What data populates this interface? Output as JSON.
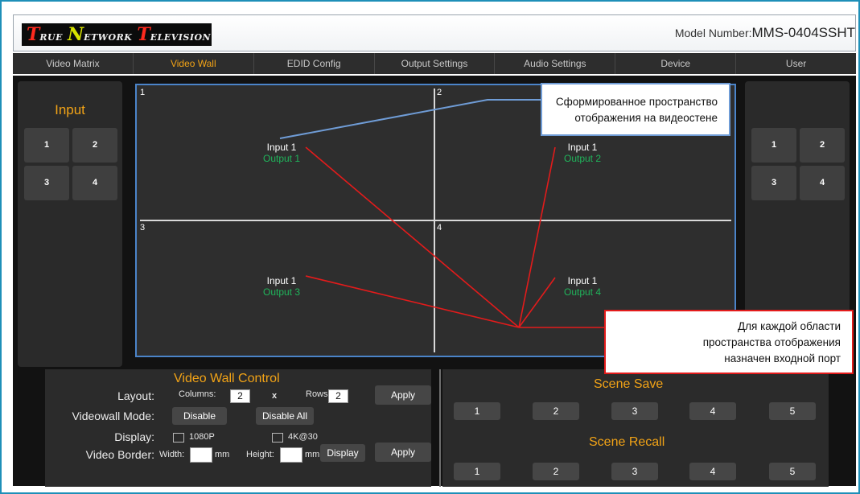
{
  "header": {
    "logo_text": "True Network Television",
    "logo_parts": [
      {
        "cap": "T",
        "rest": "RUE"
      },
      {
        "cap": "N",
        "rest": "ETWORK"
      },
      {
        "cap": "T",
        "rest": "ELEVISION"
      }
    ],
    "model_label": "Model Number:",
    "model_value": "MMS-0404SSHT"
  },
  "nav": {
    "tabs": [
      "Video Matrix",
      "Video Wall",
      "EDID Config",
      "Output Settings",
      "Audio Settings",
      "Device",
      "User"
    ],
    "active": "Video Wall"
  },
  "input_panel": {
    "title": "Input",
    "buttons": [
      "1",
      "2",
      "3",
      "4"
    ]
  },
  "output_panel": {
    "buttons": [
      "1",
      "2",
      "3",
      "4"
    ]
  },
  "wall": {
    "cells": [
      {
        "number": "1",
        "input": "Input 1",
        "output": "Output 1"
      },
      {
        "number": "2",
        "input": "Input 1",
        "output": "Output 2"
      },
      {
        "number": "3",
        "input": "Input 1",
        "output": "Output 3"
      },
      {
        "number": "4",
        "input": "Input 1",
        "output": "Output 4"
      }
    ]
  },
  "control": {
    "title": "Video Wall Control",
    "layout_label": "Layout:",
    "columns_label": "Columns:",
    "columns_value": "2",
    "x_label": "x",
    "rows_label": "Rows:",
    "rows_value": "2",
    "apply_label": "Apply",
    "mode_label": "Videowall Mode:",
    "disable_label": "Disable",
    "disable_all_label": "Disable All",
    "display_label": "Display:",
    "opt_1080p": "1080P",
    "opt_4k30": "4K@30",
    "border_label": "Video Border:",
    "width_label": "Width:",
    "mm_label": "mm",
    "height_label": "Height:",
    "display_btn_label": "Display",
    "apply2_label": "Apply"
  },
  "scene": {
    "save_title": "Scene Save",
    "save_buttons": [
      "1",
      "2",
      "3",
      "4",
      "5"
    ],
    "recall_title": "Scene Recall",
    "recall_buttons": [
      "1",
      "2",
      "3",
      "4",
      "5"
    ]
  },
  "annotations": {
    "blue_text": [
      "Сформированное пространство",
      "отображения на видеостене"
    ],
    "red_text": [
      "Для каждой области",
      "пространства отображения",
      "назначен входной порт"
    ],
    "colors": {
      "blue": "#6f9cd6",
      "red": "#e31b1b",
      "accent": "#f2a316",
      "output_green": "#20b45b"
    }
  }
}
